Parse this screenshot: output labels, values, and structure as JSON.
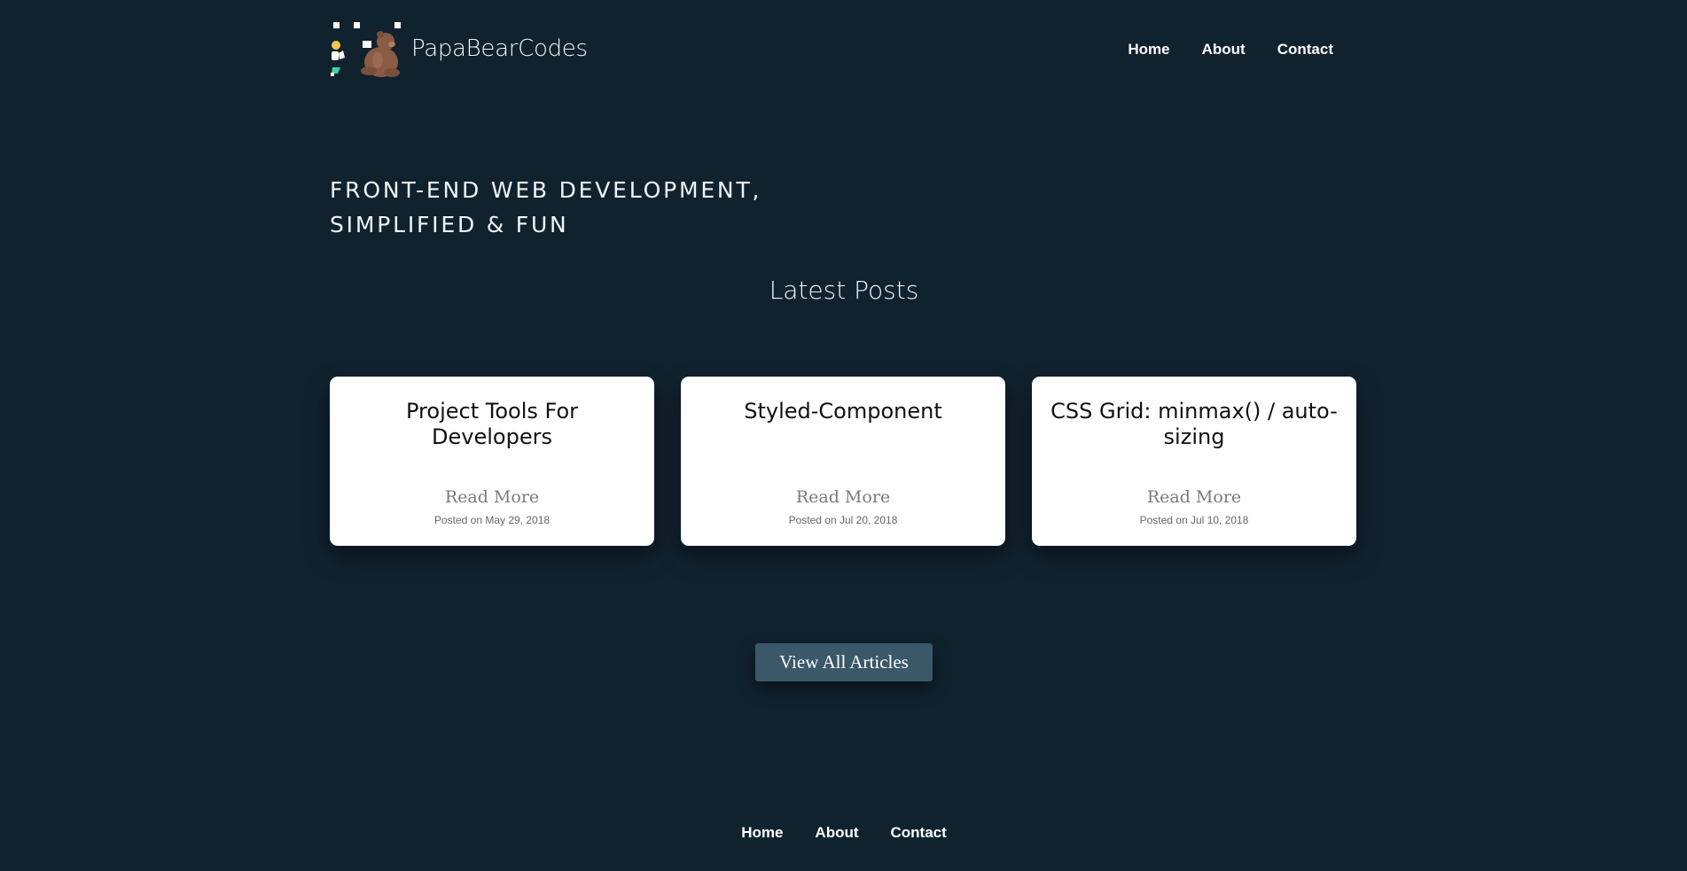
{
  "brand": {
    "name": "PapaBearCodes",
    "logo_icon": "bear-coder-logo-icon"
  },
  "nav": {
    "items": [
      {
        "label": "Home"
      },
      {
        "label": "About"
      },
      {
        "label": "Contact"
      }
    ]
  },
  "hero": {
    "tagline_line1": "FRONT-END WEB DEVELOPMENT,",
    "tagline_line2": "SIMPLIFIED & FUN"
  },
  "latest": {
    "title": "Latest Posts",
    "posts": [
      {
        "title": "Project Tools For Developers",
        "read_more": "Read More",
        "date": "Posted on May 29, 2018"
      },
      {
        "title": "Styled-Component",
        "read_more": "Read More",
        "date": "Posted on Jul 20, 2018"
      },
      {
        "title": "CSS Grid: minmax() / auto-sizing",
        "read_more": "Read More",
        "date": "Posted on Jul 10, 2018"
      }
    ]
  },
  "cta": {
    "label": "View All Articles"
  },
  "footer": {
    "items": [
      {
        "label": "Home"
      },
      {
        "label": "About"
      },
      {
        "label": "Contact"
      }
    ]
  },
  "colors": {
    "background": "#11222f",
    "card": "#ffffff",
    "button": "#3a5868"
  }
}
